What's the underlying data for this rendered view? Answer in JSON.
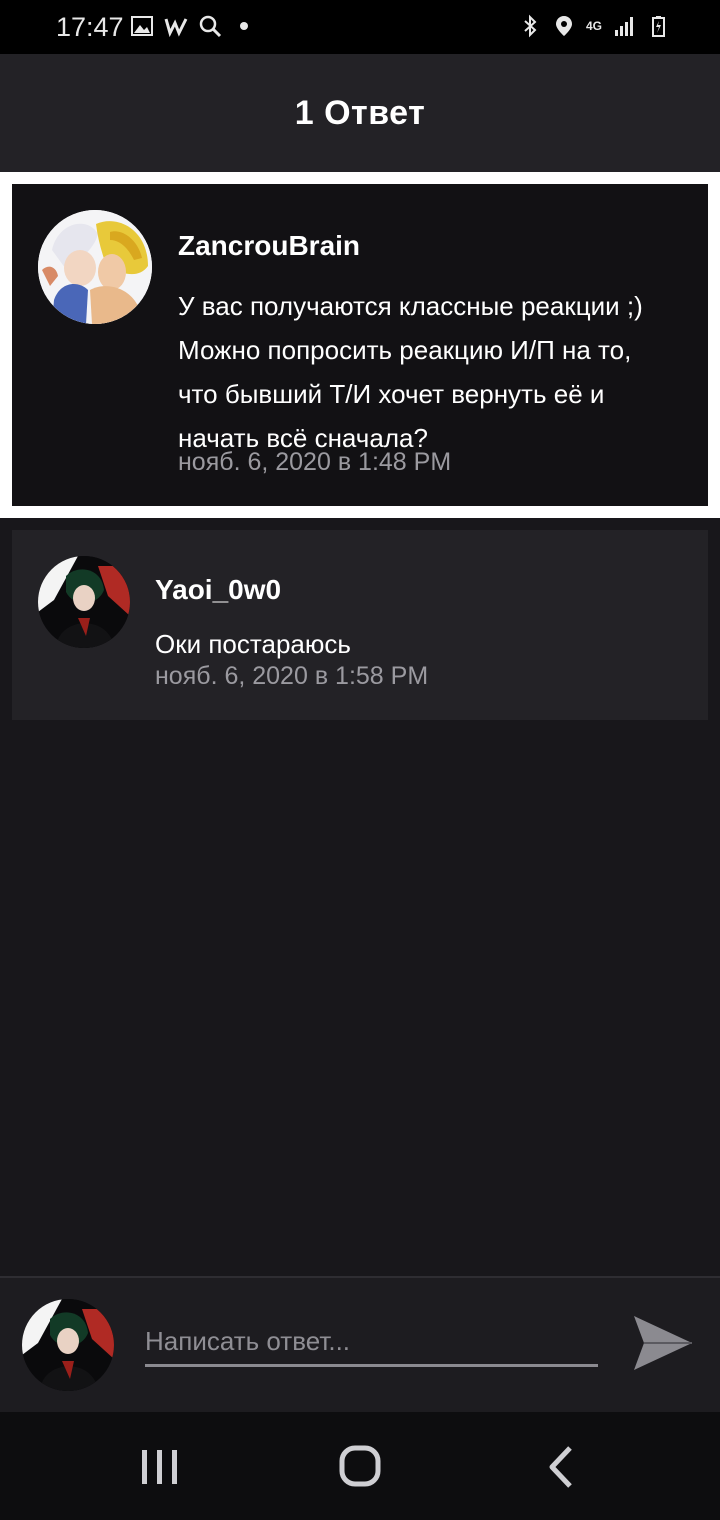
{
  "status_bar": {
    "time": "17:47",
    "left_icons": [
      "image-icon",
      "w-app-icon",
      "search-icon",
      "dot-icon"
    ],
    "right_icons": [
      "bluetooth-icon",
      "location-icon",
      "4g-icon",
      "signal-icon",
      "battery-icon"
    ],
    "network_label": "4G"
  },
  "header": {
    "title": "1 Ответ"
  },
  "parent_comment": {
    "author": "ZancrouBrain",
    "lines": [
      "У вас получаются классные реакции ;)",
      "Можно попросить реакцию И/П на то,",
      "что бывший Т/И хочет вернуть её и",
      "начать всё сначала?"
    ],
    "timestamp": "нояб. 6, 2020 в 1:48 PM"
  },
  "replies": [
    {
      "author": "Yaoi_0w0",
      "text": "Оки постараюсь",
      "timestamp": "нояб. 6, 2020 в 1:58 PM"
    }
  ],
  "composer": {
    "placeholder": "Написать ответ...",
    "send_icon": "send-icon"
  },
  "nav": {
    "buttons": [
      "recent-apps-icon",
      "home-icon",
      "back-icon"
    ]
  },
  "colors": {
    "background": "#18171b",
    "header": "#232226",
    "card": "#121114",
    "reply_card": "#232226",
    "timestamp": "#9b9aa0",
    "highlight_border": "#ffffff"
  }
}
